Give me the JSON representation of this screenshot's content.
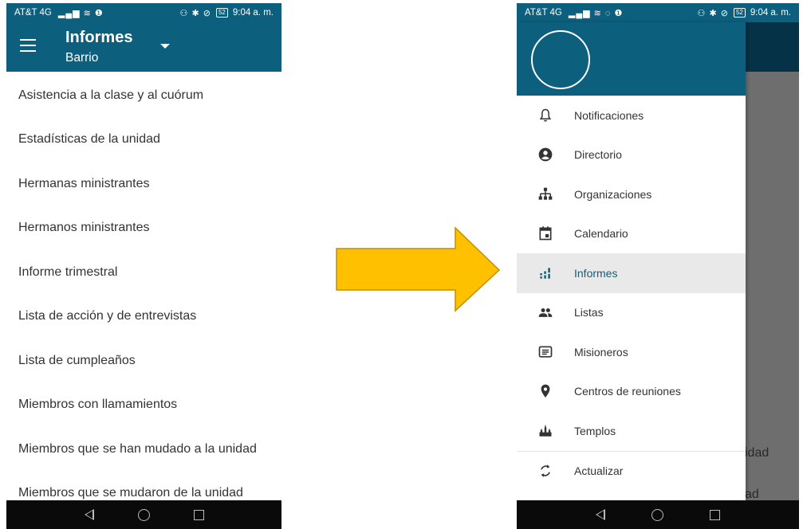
{
  "left_phone": {
    "status": {
      "carrier": "AT&T 4G",
      "time": "9:04 a. m.",
      "battery": "52"
    },
    "appbar": {
      "title": "Informes",
      "subtitle": "Barrio"
    },
    "reports": [
      "Asistencia a la clase y al cuórum",
      "Estadísticas de la unidad",
      "Hermanas ministrantes",
      "Hermanos ministrantes",
      "Informe trimestral",
      "Lista de acción y de entrevistas",
      "Lista de cumpleaños",
      "Miembros con llamamientos",
      "Miembros que se han mudado a la unidad",
      "Miembros que se mudaron de la unidad"
    ]
  },
  "right_phone": {
    "status": {
      "carrier": "AT&T 4G",
      "time": "9:04 a. m.",
      "battery": "52"
    },
    "background_fragments": [
      "idad",
      "ad"
    ],
    "menu": [
      {
        "label": "Notificaciones",
        "icon": "bell-icon"
      },
      {
        "label": "Directorio",
        "icon": "person-circle-icon"
      },
      {
        "label": "Organizaciones",
        "icon": "org-chart-icon"
      },
      {
        "label": "Calendario",
        "icon": "calendar-icon"
      },
      {
        "label": "Informes",
        "icon": "bar-chart-icon",
        "active": true
      },
      {
        "label": "Listas",
        "icon": "people-icon"
      },
      {
        "label": "Misioneros",
        "icon": "message-icon"
      },
      {
        "label": "Centros de reuniones",
        "icon": "location-pin-icon"
      },
      {
        "label": "Templos",
        "icon": "temple-icon"
      },
      {
        "label": "Actualizar",
        "icon": "refresh-icon"
      }
    ]
  },
  "colors": {
    "primary": "#0d5f7e",
    "arrow_fill": "#ffc000",
    "arrow_stroke": "#c09000",
    "active_bg": "#e9e9e9"
  }
}
